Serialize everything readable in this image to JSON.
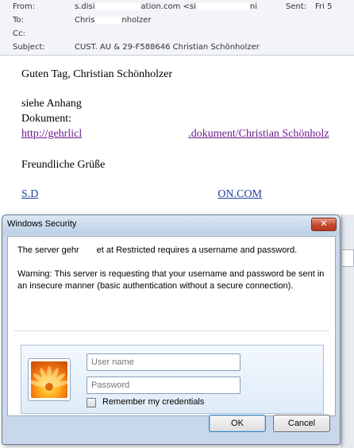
{
  "email": {
    "from_label": "From:",
    "from_value_a": "s.disi",
    "from_value_b": "ation.com <si",
    "from_value_c": "ni",
    "sent_label": "Sent:",
    "sent_value": "Fri 5",
    "to_label": "To:",
    "to_value_a": "Chris",
    "to_value_b": "nholzer",
    "cc_label": "Cc:",
    "subject_label": "Subject:",
    "subject_value": "CUST. AU & 29-F588646 Christian Schönholzer"
  },
  "body": {
    "greeting": "Guten Tag, Christian Schönholzer",
    "line1": "siehe Anhang",
    "line2": "Dokument:",
    "link_a": "http://gehrlicl",
    "link_b": ".dokument/Christian Schönholz",
    "closing": "Freundliche Grüße",
    "sig_a": "S.D",
    "sig_b": "ON.COM"
  },
  "dialog": {
    "title": "Windows Security",
    "close_symbol": "✕",
    "message1_a": "The server gehr",
    "message1_b": "et at Restricted requires a username and password.",
    "message2": "Warning: This server is requesting that your username and password be sent in an insecure manner (basic authentication without a secure connection).",
    "username_placeholder": "User name",
    "password_placeholder": "Password",
    "remember_label": "Remember my credentials",
    "ok_label": "OK",
    "cancel_label": "Cancel",
    "avatar_icon": "flower-user-icon"
  }
}
